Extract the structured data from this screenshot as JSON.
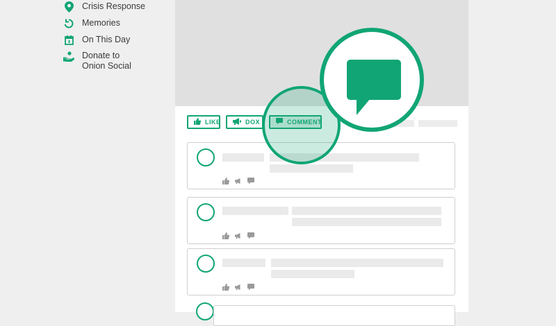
{
  "sidebar": {
    "items": [
      {
        "label": "Crisis Response",
        "icon": "location-pin-icon"
      },
      {
        "label": "Memories",
        "icon": "refresh-icon"
      },
      {
        "label": "On This Day",
        "icon": "calendar-icon"
      },
      {
        "label": "Donate to\nOnion Social",
        "icon": "donate-hand-icon"
      }
    ]
  },
  "actions": {
    "like_label": "LIKE",
    "dox_label": "DOX",
    "comment_label": "COMMENT"
  },
  "colors": {
    "accent": "#11a575",
    "placeholder": "#eaeaea",
    "cover": "#e0e0e0",
    "background": "#efefef"
  },
  "overlay": {
    "magnified_icon": "comment-bubble-icon"
  }
}
